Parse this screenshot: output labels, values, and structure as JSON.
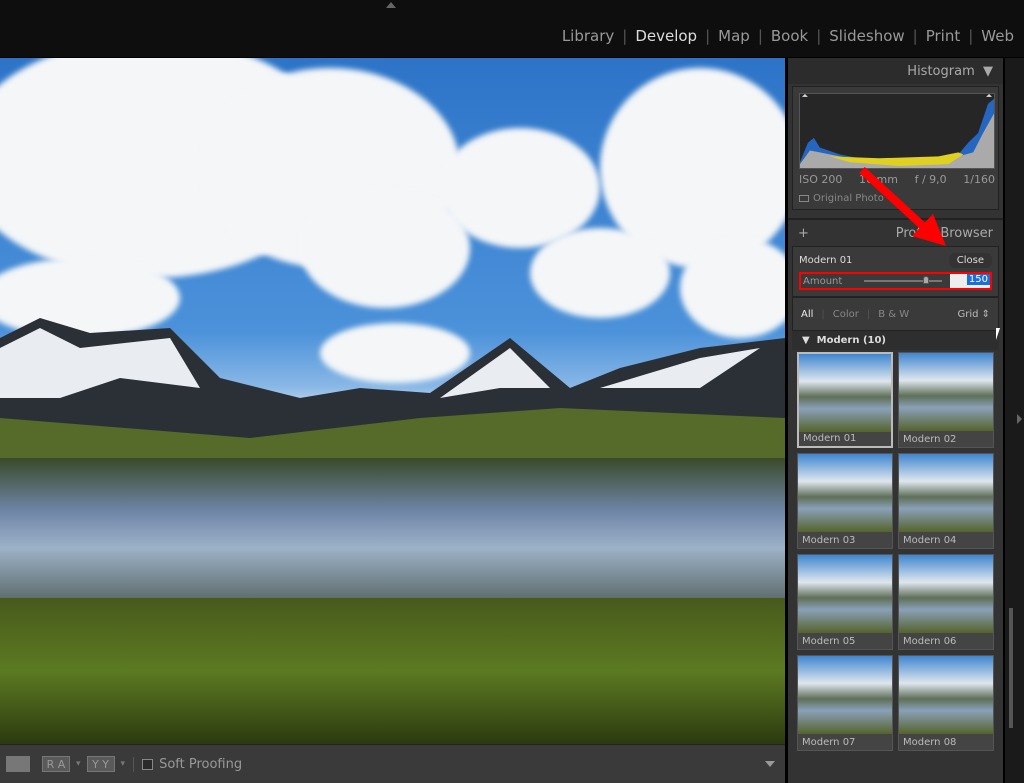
{
  "modules": [
    "Library",
    "Develop",
    "Map",
    "Book",
    "Slideshow",
    "Print",
    "Web"
  ],
  "active_module": "Develop",
  "histogram": {
    "title": "Histogram",
    "iso": "ISO 200",
    "focal": "16 mm",
    "aperture": "f / 9,0",
    "shutter": "1/160",
    "original_photo": "Original Photo"
  },
  "profile_browser": {
    "title": "Profile Browser",
    "profile": "Modern 01",
    "close": "Close",
    "amount_label": "Amount",
    "amount_value": "150",
    "amount_fraction": 0.75,
    "filters": [
      "All",
      "Color",
      "B & W"
    ],
    "view": "Grid ⇕",
    "group": "Modern (10)",
    "thumbs": [
      "Modern 01",
      "Modern 02",
      "Modern 03",
      "Modern 04",
      "Modern 05",
      "Modern 06",
      "Modern 07",
      "Modern 08"
    ]
  },
  "toolbar": {
    "ra": "R A",
    "yy": "Y Y",
    "soft_proofing": "Soft Proofing"
  },
  "colors": {
    "highlight": "#ff0000",
    "selection": "#1a6fd8"
  }
}
